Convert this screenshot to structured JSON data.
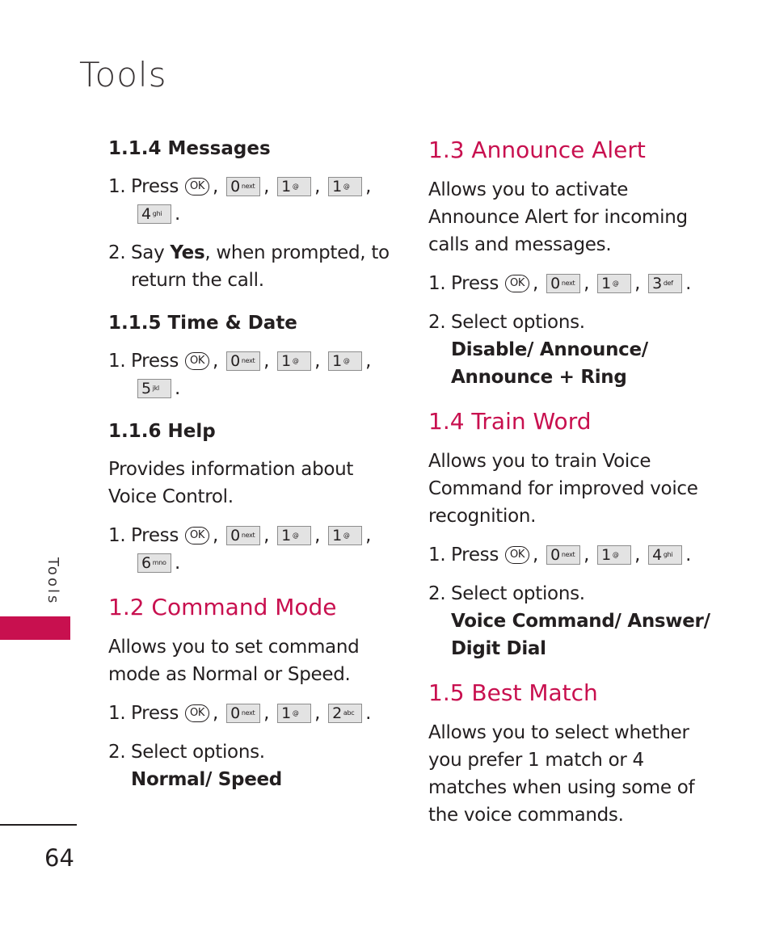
{
  "page": {
    "title": "Tools",
    "side_label": "Tools",
    "page_number": "64",
    "accent_color": "#c8104f"
  },
  "left": {
    "messages": {
      "heading": "1.1.4 Messages",
      "step1_num": "1.",
      "step1_text": "Press",
      "keys": [
        "OK",
        "0",
        "1",
        "1",
        "4"
      ],
      "key_subs": [
        "",
        "next",
        "@",
        "@",
        "ghi"
      ],
      "step2_num": "2.",
      "step2_pre": "Say ",
      "step2_bold": "Yes",
      "step2_post": ", when prompted, to return the call."
    },
    "time_date": {
      "heading": "1.1.5 Time & Date",
      "step1_num": "1.",
      "step1_text": "Press",
      "keys": [
        "OK",
        "0",
        "1",
        "1",
        "5"
      ],
      "key_subs": [
        "",
        "next",
        "@",
        "@",
        "jkl"
      ]
    },
    "help": {
      "heading": "1.1.6 Help",
      "description": "Provides information about Voice Control.",
      "step1_num": "1.",
      "step1_text": "Press",
      "keys": [
        "OK",
        "0",
        "1",
        "1",
        "6"
      ],
      "key_subs": [
        "",
        "next",
        "@",
        "@",
        "mno"
      ]
    },
    "command_mode": {
      "heading": "1.2 Command Mode",
      "description": "Allows you to set command mode as Normal or Speed.",
      "step1_num": "1.",
      "step1_text": "Press",
      "keys": [
        "OK",
        "0",
        "1",
        "2"
      ],
      "key_subs": [
        "",
        "next",
        "@",
        "abc"
      ],
      "step2_num": "2.",
      "step2_text": "Select options.",
      "options": "Normal/ Speed"
    }
  },
  "right": {
    "announce_alert": {
      "heading": "1.3 Announce Alert",
      "description": "Allows you to activate Announce Alert for incoming calls and messages.",
      "step1_num": "1.",
      "step1_text": "Press",
      "keys": [
        "OK",
        "0",
        "1",
        "3"
      ],
      "key_subs": [
        "",
        "next",
        "@",
        "def"
      ],
      "step2_num": "2.",
      "step2_text": "Select options.",
      "options": "Disable/ Announce/ Announce + Ring"
    },
    "train_word": {
      "heading": "1.4 Train Word",
      "description": "Allows you to train Voice Command for improved voice recognition.",
      "step1_num": "1.",
      "step1_text": "Press",
      "keys": [
        "OK",
        "0",
        "1",
        "4"
      ],
      "key_subs": [
        "",
        "next",
        "@",
        "ghi"
      ],
      "step2_num": "2.",
      "step2_text": "Select options.",
      "options": "Voice Command/ Answer/ Digit Dial"
    },
    "best_match": {
      "heading": "1.5 Best Match",
      "description": "Allows you to select whether you prefer 1 match or 4 matches when using some of the voice commands."
    }
  }
}
